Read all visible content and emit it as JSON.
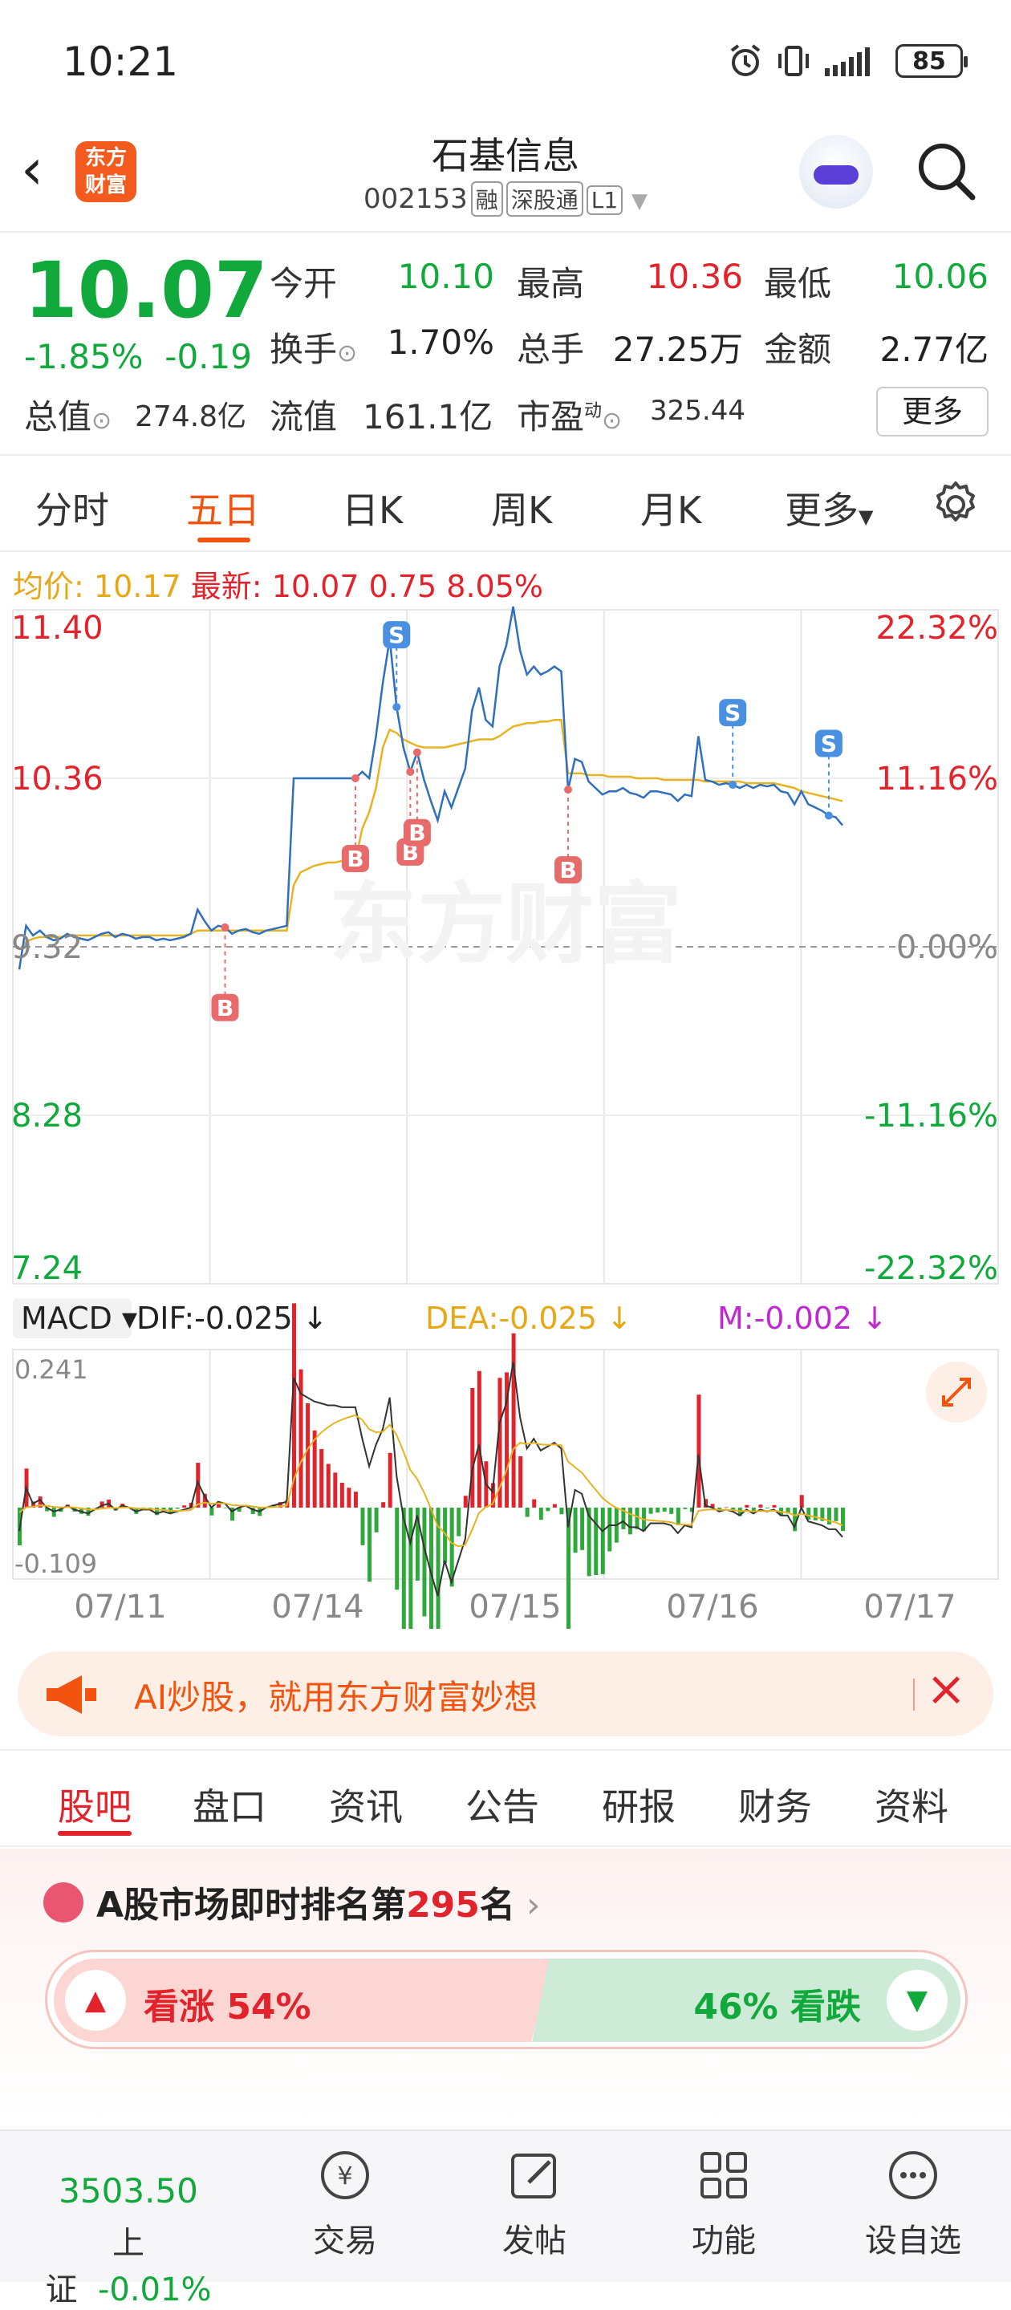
{
  "status_bar": {
    "time": "10:21",
    "battery": "85"
  },
  "header": {
    "logo_text": "东方财富",
    "stock_name": "石基信息",
    "stock_code": "002153",
    "tags": [
      "融",
      "深股通",
      "L1"
    ]
  },
  "quote": {
    "price": "10.07",
    "change_pct": "-1.85%",
    "change": "-0.19",
    "rows": [
      [
        {
          "label": "今开",
          "value": "10.10",
          "color": "green"
        },
        {
          "label": "最高",
          "value": "10.36",
          "color": "red"
        },
        {
          "label": "最低",
          "value": "10.06",
          "color": "green"
        }
      ],
      [
        {
          "label": "换手",
          "value": "1.70%",
          "color": "black"
        },
        {
          "label": "总手",
          "value": "27.25万",
          "color": "black"
        },
        {
          "label": "金额",
          "value": "2.77亿",
          "color": "black"
        }
      ]
    ],
    "total_value_label": "总值",
    "total_value": "274.8亿",
    "float_value_label": "流值",
    "float_value": "161.1亿",
    "pe_label": "市盈",
    "pe_sup": "动",
    "pe_value": "325.44",
    "more_button": "更多"
  },
  "chart_tabs": {
    "items": [
      "分时",
      "五日",
      "日K",
      "周K",
      "月K",
      "更多"
    ],
    "active": "五日"
  },
  "info_line": {
    "avg_label": "均价:",
    "avg_value": "10.17",
    "latest_label": "最新:",
    "latest_value": "10.07",
    "latest_vol": "0.75",
    "latest_pct": "8.05%"
  },
  "chart_data": {
    "type": "line",
    "title": "",
    "y_left_labels": [
      "11.40",
      "10.36",
      "9.32",
      "8.28",
      "7.24"
    ],
    "y_right_labels": [
      "22.32%",
      "11.16%",
      "0.00%",
      "-11.16%",
      "-22.32%"
    ],
    "ylim": [
      7.24,
      11.4
    ],
    "prev_close": 9.32,
    "x_labels": [
      "07/11",
      "07/14",
      "07/15",
      "07/16",
      "07/17"
    ],
    "series": [
      {
        "values": [
          9.18,
          9.45,
          9.39,
          9.42,
          9.38,
          9.36,
          9.37,
          9.4,
          9.38,
          9.37,
          9.36,
          9.38,
          9.4,
          9.41,
          9.38,
          9.4,
          9.39,
          9.37,
          9.38,
          9.38,
          9.36,
          9.37,
          9.36,
          9.37,
          9.38,
          9.4,
          9.55,
          9.48,
          9.42,
          9.45,
          9.44,
          9.4,
          9.42,
          9.43,
          9.41,
          9.4,
          9.42,
          9.43,
          9.44,
          9.45,
          10.36,
          10.36,
          10.36,
          10.36,
          10.36,
          10.36,
          10.36,
          10.36,
          10.36,
          10.36,
          10.4,
          10.36,
          10.62,
          10.95,
          11.22,
          10.8,
          10.55,
          10.4,
          10.52,
          10.35,
          10.22,
          10.1,
          10.28,
          10.18,
          10.3,
          10.42,
          10.78,
          10.92,
          10.72,
          10.68,
          11.05,
          11.18,
          11.42,
          11.15,
          11.0,
          11.05,
          11.0,
          11.02,
          11.05,
          11.02,
          10.29,
          10.48,
          10.46,
          10.34,
          10.3,
          10.26,
          10.28,
          10.28,
          10.3,
          10.27,
          10.26,
          10.24,
          10.28,
          10.28,
          10.27,
          10.26,
          10.22,
          10.26,
          10.25,
          10.62,
          10.35,
          10.34,
          10.32,
          10.33,
          10.32,
          10.3,
          10.32,
          10.3,
          10.32,
          10.31,
          10.32,
          10.28,
          10.27,
          10.2,
          10.28,
          10.2,
          10.18,
          10.16,
          10.13,
          10.12,
          10.07
        ]
      },
      {
        "values": [
          9.3,
          9.35,
          9.37,
          9.38,
          9.38,
          9.38,
          9.38,
          9.39,
          9.39,
          9.39,
          9.39,
          9.39,
          9.39,
          9.39,
          9.39,
          9.39,
          9.39,
          9.39,
          9.39,
          9.39,
          9.39,
          9.39,
          9.39,
          9.39,
          9.39,
          9.4,
          9.42,
          9.42,
          9.42,
          9.42,
          9.42,
          9.42,
          9.42,
          9.42,
          9.42,
          9.42,
          9.42,
          9.42,
          9.42,
          9.42,
          9.7,
          9.78,
          9.8,
          9.82,
          9.83,
          9.84,
          9.84,
          9.85,
          9.85,
          9.85,
          10.05,
          10.15,
          10.3,
          10.55,
          10.66,
          10.64,
          10.6,
          10.58,
          10.56,
          10.55,
          10.55,
          10.55,
          10.55,
          10.56,
          10.57,
          10.58,
          10.59,
          10.6,
          10.6,
          10.6,
          10.62,
          10.65,
          10.68,
          10.69,
          10.7,
          10.7,
          10.71,
          10.71,
          10.72,
          10.72,
          10.39,
          10.39,
          10.39,
          10.38,
          10.38,
          10.38,
          10.37,
          10.37,
          10.37,
          10.37,
          10.36,
          10.36,
          10.36,
          10.36,
          10.35,
          10.35,
          10.35,
          10.35,
          10.35,
          10.35,
          10.34,
          10.34,
          10.34,
          10.34,
          10.34,
          10.34,
          10.33,
          10.33,
          10.33,
          10.33,
          10.33,
          10.32,
          10.31,
          10.3,
          10.28,
          10.27,
          10.26,
          10.25,
          10.24,
          10.23,
          10.22
        ]
      }
    ]
  },
  "macd": {
    "label": "MACD",
    "dif": "DIF:-0.025",
    "dea": "DEA:-0.025",
    "m": "M:-0.002",
    "top": "0.241",
    "bottom": "-0.109"
  },
  "ad": {
    "text": "AI炒股，就用东方财富妙想"
  },
  "section_tabs": {
    "items": [
      "股吧",
      "盘口",
      "资讯",
      "公告",
      "研报",
      "财务",
      "资料"
    ],
    "active": "股吧"
  },
  "rank": {
    "prefix": "A股市场即时排名第",
    "number": "295",
    "suffix": "名"
  },
  "sentiment": {
    "bull": "看涨 54%",
    "bear": "46% 看跌",
    "bull_fraction": 0.54
  },
  "bottom_nav": {
    "index_value": "3503.50",
    "index_name": "上证",
    "index_change": "-0.01%",
    "items": [
      "交易",
      "发帖",
      "功能",
      "设自选"
    ]
  }
}
